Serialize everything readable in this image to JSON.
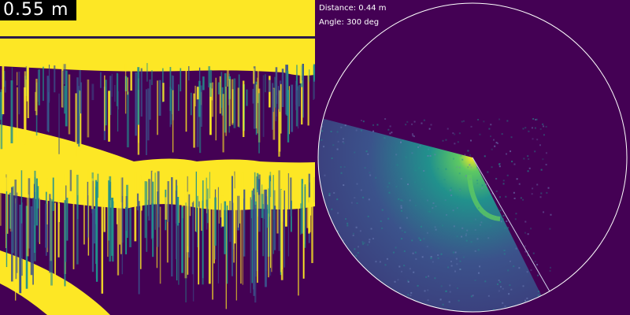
{
  "echogram": {
    "range_label": "0.55 m"
  },
  "sonar": {
    "distance_text": "Distance: 0.44 m",
    "angle_text": "Angle: 300 deg"
  },
  "colors": {
    "background": "#440154",
    "echo_high": "#fde725",
    "echo_mid": "#21918c",
    "echo_low": "#3b528b",
    "ring": "#ffffff",
    "badge": "#000000"
  }
}
